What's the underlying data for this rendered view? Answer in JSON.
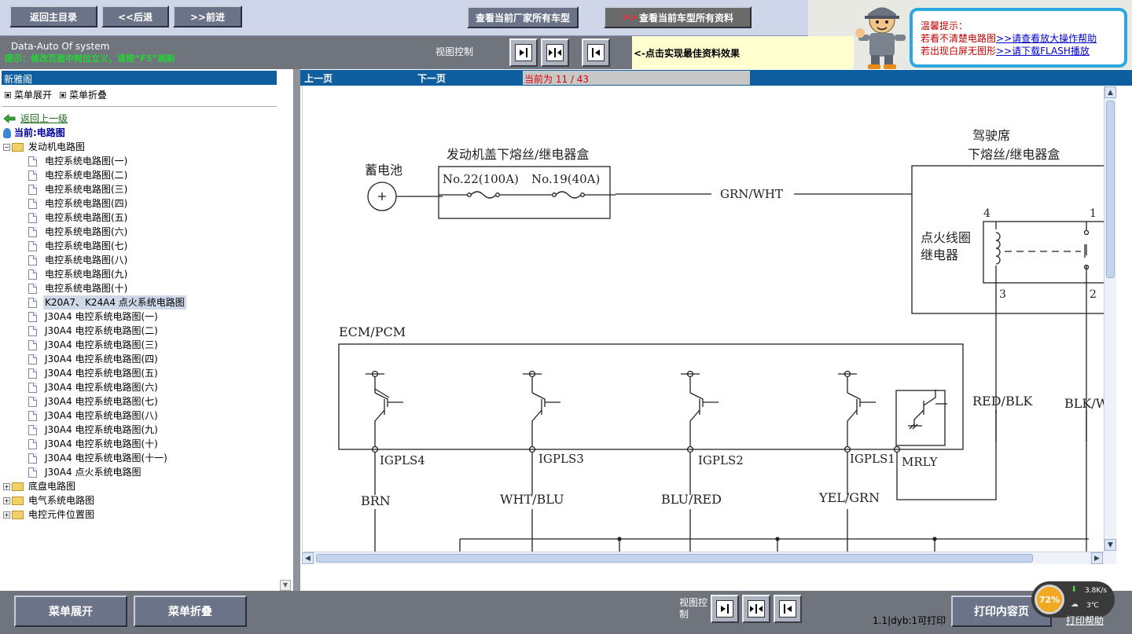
{
  "top": {
    "home_label": "返回主目录",
    "back_label": "<<后退",
    "forward_label": ">>前进",
    "models_label": "查看当前厂家所有车型",
    "alldata_arrow": ">>",
    "alldata_label": "查看当前车型所有资料",
    "brand": "Data-Auto Of system",
    "hint": "提示：修改页面中岗位立义，请按“F5”刷新",
    "view_control_label": "视图控制",
    "best_effect": "<-点击实现最佳资料效果"
  },
  "tips": {
    "title": "温馨提示：",
    "line1_prefix": "若看不清楚电路图",
    "line1_link": ">>请查看放大操作帮助",
    "line2_prefix": "若出现白屏无图形",
    "line2_link": ">>请下载FLASH播放"
  },
  "sidebar": {
    "title": "新雅阁",
    "expand_menu": "菜单展开",
    "collapse_menu": "菜单折叠",
    "back_link": "返回上一级",
    "current_label": "当前:电路图",
    "root_folder": "发动机电路图",
    "items": [
      "电控系统电路图(一)",
      "电控系统电路图(二)",
      "电控系统电路图(三)",
      "电控系统电路图(四)",
      "电控系统电路图(五)",
      "电控系统电路图(六)",
      "电控系统电路图(七)",
      "电控系统电路图(八)",
      "电控系统电路图(九)",
      "电控系统电路图(十)",
      "K20A7、K24A4 点火系统电路图",
      "J30A4 电控系统电路图(一)",
      "J30A4 电控系统电路图(二)",
      "J30A4 电控系统电路图(三)",
      "J30A4 电控系统电路图(四)",
      "J30A4 电控系统电路图(五)",
      "J30A4 电控系统电路图(六)",
      "J30A4 电控系统电路图(七)",
      "J30A4 电控系统电路图(八)",
      "J30A4 电控系统电路图(九)",
      "J30A4 电控系统电路图(十)",
      "J30A4 电控系统电路图(十一)",
      "J30A4 点火系统电路图"
    ],
    "selected_index": 10,
    "other_folders": [
      "底盘电路图",
      "电气系统电路图",
      "电控元件位置图"
    ]
  },
  "nav": {
    "prev": "上一页",
    "next": "下一页",
    "page_indicator": "当前为  11 / 43"
  },
  "diagram": {
    "battery": "蓄电池",
    "underhood_box": "发动机盖下熔丝/继电器盒",
    "fuse1": "No.22(100A)",
    "fuse2": "No.19(40A)",
    "wire_main": "GRN/WHT",
    "dash_box_line1": "驾驶席",
    "dash_box_line2": "下熔丝/继电器盒",
    "relay_line1": "点火线圈",
    "relay_line2": "继电器",
    "pin4": "4",
    "pin1": "1",
    "pin3": "3",
    "pin2": "2",
    "ecm": "ECM/PCM",
    "igpls4": "IGPLS4",
    "igpls3": "IGPLS3",
    "igpls2": "IGPLS2",
    "igpls1": "IGPLS1",
    "mrly": "MRLY",
    "wire_brn": "BRN",
    "wire_wht_blu": "WHT/BLU",
    "wire_blu_red": "BLU/RED",
    "wire_yel_grn": "YEL/GRN",
    "wire_red_blk": "RED/BLK",
    "wire_blk_wh": "BLK/WH"
  },
  "bottom": {
    "expand": "菜单展开",
    "collapse": "菜单折叠",
    "view_control_label": "视图控制",
    "status": "1.1|dyb:1可打印",
    "print": "打印内容页",
    "print_help": "打印帮助"
  },
  "gadget": {
    "percent": "72%",
    "speed": "3.8K/s",
    "temp": "3℃"
  },
  "colors": {
    "panel_blue": "#0f5fa0",
    "toolbar_gray": "#6f747d",
    "hint_green": "#22d633",
    "page_red": "#e00000",
    "tip_border": "#2ea6e0"
  }
}
